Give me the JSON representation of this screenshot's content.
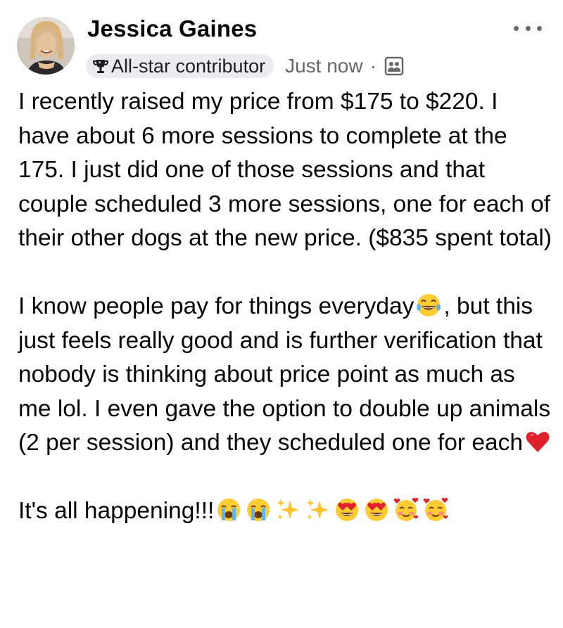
{
  "author": {
    "name": "Jessica Gaines",
    "badge_label": "All-star contributor"
  },
  "meta": {
    "timestamp": "Just now",
    "separator": "·"
  },
  "icons": {
    "badge": "trophy-icon",
    "audience": "group-icon",
    "menu": "more-options-icon"
  },
  "post": {
    "paragraph1": "I recently raised my price from $175 to $220. I have about 6 more sessions to complete at the 175. I just did one of those sessions and that couple scheduled 3 more sessions, one for each of their other dogs at the new price. ($835 spent total)",
    "paragraph2_part1": "I know people pay for things everyday",
    "paragraph2_part2": ", but this just feels really good and is further verification that nobody is thinking about price point as much as me lol. I even gave the option to double up animals (2 per session) and they scheduled one for each",
    "paragraph3": "It's all happening!!!"
  },
  "colors": {
    "text": "#050505",
    "secondary": "#65676b",
    "badge_bg": "#ebecf0"
  }
}
